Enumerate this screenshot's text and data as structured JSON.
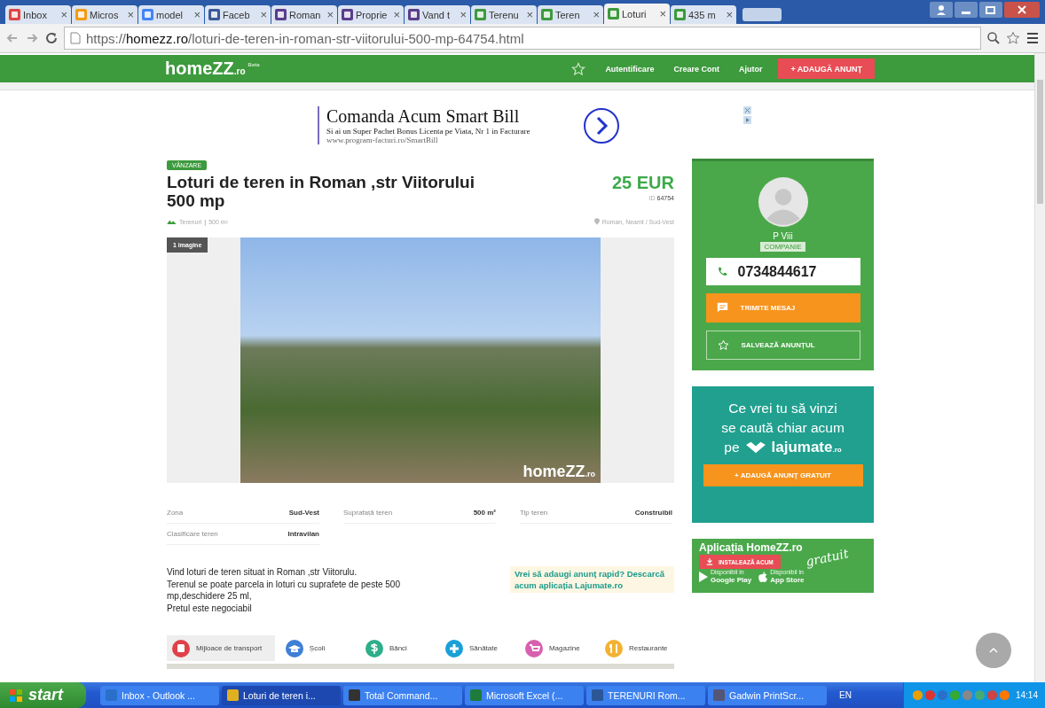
{
  "browser": {
    "tabs": [
      {
        "label": "Inbox",
        "kind": "gmail",
        "selected": false
      },
      {
        "label": "Micros",
        "kind": "outlook",
        "selected": false
      },
      {
        "label": "model",
        "kind": "google",
        "selected": false
      },
      {
        "label": "Faceb",
        "kind": "facebook",
        "selected": false
      },
      {
        "label": "Roman",
        "kind": "olx",
        "selected": false
      },
      {
        "label": "Proprie",
        "kind": "olx",
        "selected": false
      },
      {
        "label": "Vand t",
        "kind": "olx",
        "selected": false
      },
      {
        "label": "Terenu",
        "kind": "zz",
        "selected": false
      },
      {
        "label": "Teren",
        "kind": "zz",
        "selected": false
      },
      {
        "label": "Loturi",
        "kind": "zz",
        "selected": true
      },
      {
        "label": "435 m",
        "kind": "zz",
        "selected": false
      }
    ],
    "close_glyph": "×",
    "url_prefix": "https://",
    "url_host": "homezz.ro",
    "url_path": "/loturi-de-teren-in-roman-str-viitorului-500-mp-64754.html"
  },
  "header": {
    "logo": "homeZZ",
    "logo_suffix": ".ro",
    "logo_tag": "Beta",
    "nav": [
      "Autentificare",
      "Creare Cont",
      "Ajutor"
    ],
    "add_button": "+ ADAUGĂ ANUNȚ"
  },
  "ad": {
    "title": "Comanda Acum Smart Bill",
    "text": "Si ai un Super Pachet Bonus Licenta pe Viata, Nr 1 in Facturare",
    "url": "www.program-facturi.ro/SmartBill"
  },
  "listing": {
    "badge": "VÂNZARE",
    "title": "Loturi de teren in Roman ,str Viitorului 500 mp",
    "price": "25 EUR",
    "id_label": "ID",
    "id": "64754",
    "category": "Terenuri",
    "separator": "|",
    "area": "500 m²",
    "location": "Roman, Neamt / Sud-Vest",
    "image_count": "1 imagine",
    "watermark": "homeZZ",
    "watermark_suffix": ".ro"
  },
  "details": [
    {
      "label": "Zona",
      "value": "Sud-Vest"
    },
    {
      "label": "Suprafață teren",
      "value": "500 m²"
    },
    {
      "label": "Tip teren",
      "value": "Construibil"
    },
    {
      "label": "Clasificare teren",
      "value": "Intravilan"
    }
  ],
  "description": [
    "Vind loturi de teren situat in Roman ,str Viitorulu.",
    "Terenul se poate parcela in loturi cu suprafete de peste 500 mp,deschidere 25 ml,",
    "Pretul este negociabil"
  ],
  "app_promo": "Vrei să adaugi anunț rapid? Descarcă acum aplicația Lajumate.ro",
  "poi_tabs": [
    {
      "label": "Mijloace de transport",
      "kind": "bus",
      "color": "#e0404a",
      "selected": true
    },
    {
      "label": "Școli",
      "kind": "cap",
      "color": "#3f7fd6",
      "selected": false
    },
    {
      "label": "Bănci",
      "kind": "dollar",
      "color": "#2eae8a",
      "selected": false
    },
    {
      "label": "Sănătate",
      "kind": "plus",
      "color": "#1aa0d8",
      "selected": false
    },
    {
      "label": "Magazine",
      "kind": "cart",
      "color": "#d860b0",
      "selected": false
    },
    {
      "label": "Restaurante",
      "kind": "fork",
      "color": "#f2b233",
      "selected": false
    }
  ],
  "seller": {
    "name": "P Viii",
    "type": "COMPANIE",
    "phone": "0734844617",
    "message_button": "TRIMITE MESAJ",
    "save_button": "SALVEAZĂ ANUNȚUL"
  },
  "lajumate": {
    "line1": "Ce vrei tu să vinzi",
    "line2": "se caută chiar acum",
    "pe": "pe",
    "brand": "lajumate",
    "brand_suffix": ".ro",
    "button": "+ ADAUGĂ ANUNȚ GRATUIT"
  },
  "app_banner": {
    "title": "Aplicația HomeZZ.ro",
    "install": "INSTALEAZĂ ACUM",
    "gratuit": "gratuit",
    "google_small": "Disponibil in",
    "google": "Google Play",
    "apple_small": "Disponibil in",
    "apple": "App Store"
  },
  "taskbar": {
    "start": "start",
    "items": [
      {
        "label": "Inbox - Outlook ...",
        "kind": "outlook",
        "selected": false
      },
      {
        "label": "Loturi de teren i...",
        "kind": "chrome",
        "selected": true
      },
      {
        "label": "Total Command...",
        "kind": "disk",
        "selected": false
      },
      {
        "label": "Microsoft Excel (...",
        "kind": "excel",
        "selected": false
      },
      {
        "label": "TERENURI Rom...",
        "kind": "word",
        "selected": false
      },
      {
        "label": "Gadwin PrintScr...",
        "kind": "printer",
        "selected": false
      }
    ],
    "language": "EN",
    "time": "14:14"
  }
}
